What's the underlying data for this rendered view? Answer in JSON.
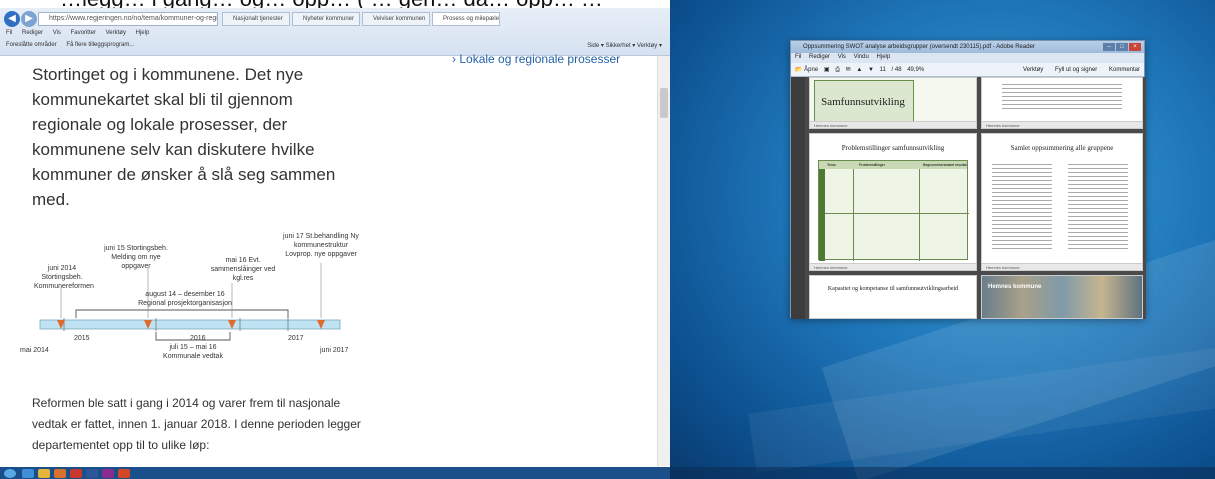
{
  "caption_fragment": "…legg… i gang… og… opp… ( … gen… da… opp… …",
  "browser": {
    "address": "https://www.regjeringen.no/no/tema/kommuner-og-regioner/kommunereform/t...",
    "tabs": [
      "Nasjonalt tjenester",
      "Nyheter kommuner",
      "Veiviser kommunen",
      "Prosess og milepæler"
    ],
    "menu": [
      "Fil",
      "Rediger",
      "Vis",
      "Favoritter",
      "Verktøy",
      "Hjelp"
    ],
    "favorites": [
      "Foreslåtte områder",
      "Få flere tilleggsprogram..."
    ],
    "right_tools": [
      "Side",
      "Sikkerhet",
      "Verktøy"
    ]
  },
  "article": {
    "paragraph1": "Stortinget og i kommunene. Det nye kommunekartet skal bli til gjennom regionale og lokale prosesser, der kommunene selv kan diskutere hvilke kommuner de ønsker å slå seg sammen med.",
    "side_link": "Lokale og regionale prosesser",
    "paragraph2": "Reformen ble satt i gang i 2014 og varer frem til nasjonale vedtak er fattet, innen 1. januar 2018. I denne perioden legger departementet opp til to ulike løp:"
  },
  "timeline": {
    "labels_above": [
      "juni 2014 Stortingsbeh. Kommunereformen",
      "juni 15 Stortingsbeh. Melding om nye oppgaver",
      "august 14 – desember 16 Regional prosjektorganisasjon",
      "mai 16 Evt. sammenslåinger ved kgl.res",
      "juni 17 St.behandling Ny kommunestruktur Lovprop. nye oppgaver"
    ],
    "years": [
      "2015",
      "2016",
      "2017"
    ],
    "start": "mai 2014",
    "end": "juni 2017",
    "below_bracket": "juli 15 – mai 16 Kommunale vedtak"
  },
  "pdf_window": {
    "title": "Oppsummering SWOT analyse arbeidsgrupper (oversendt 230115).pdf - Adobe Reader",
    "menu": [
      "Fil",
      "Rediger",
      "Vis",
      "Vindu",
      "Hjelp"
    ],
    "toolbar_open": "Åpne",
    "page": "11",
    "page_total": "/ 48",
    "zoom": "49,9%",
    "right_tools": [
      "Verktøy",
      "Fyll ut og signer",
      "Kommentar"
    ],
    "slide1_title": "Samfunnsutvikling",
    "slide2_title": "Problemstillinger samfunnsutvikling",
    "slide3_title": "Samlet oppsummering alle gruppene",
    "slide4_title": "Kapasitet og kompetanse til samfunnsutviklingsarbeid",
    "slide4_banner": "Hemnes kommune",
    "slide_footer": "Hemnes kommune",
    "table_head": [
      "Tema",
      "Problemstillinger",
      "Begrunnelse/ønsket resultat"
    ]
  },
  "colors": {
    "link": "#2461a8",
    "timeline_bar": "#bfe3f2",
    "marker": "#e06a2e",
    "slide_green": "#dbe8cf"
  }
}
